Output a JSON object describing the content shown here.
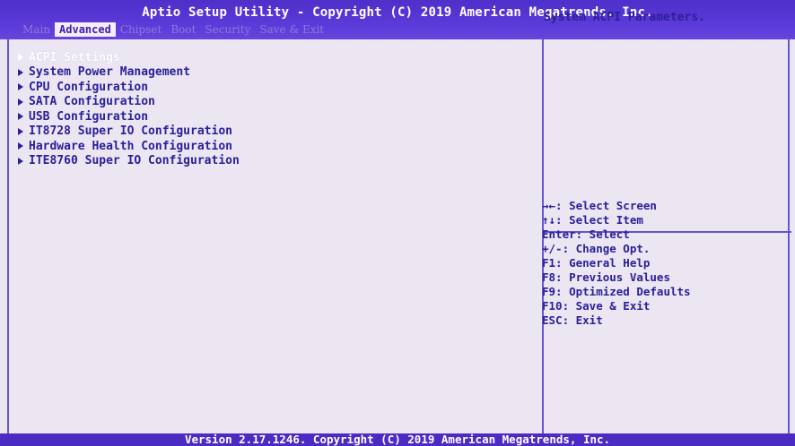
{
  "header": {
    "title": "Aptio Setup Utility - Copyright (C) 2019 American Megatrends, Inc.",
    "tabs": [
      {
        "label": "Main",
        "active": false
      },
      {
        "label": "Advanced",
        "active": true
      },
      {
        "label": "Chipset",
        "active": false
      },
      {
        "label": "Boot",
        "active": false
      },
      {
        "label": "Security",
        "active": false
      },
      {
        "label": "Save & Exit",
        "active": false
      }
    ]
  },
  "menu": {
    "items": [
      {
        "label": "ACPI Settings",
        "selected": true
      },
      {
        "label": "System Power Management",
        "selected": false
      },
      {
        "label": "CPU Configuration",
        "selected": false
      },
      {
        "label": "SATA Configuration",
        "selected": false
      },
      {
        "label": "USB Configuration",
        "selected": false
      },
      {
        "label": "IT8728 Super IO Configuration",
        "selected": false
      },
      {
        "label": "Hardware Health Configuration",
        "selected": false
      },
      {
        "label": "ITE8760 Super IO Configuration",
        "selected": false
      }
    ]
  },
  "help": {
    "description": "System ACPI Parameters.",
    "keys": [
      "→←: Select Screen",
      "↑↓: Select Item",
      "Enter: Select",
      "+/-: Change Opt.",
      "F1: General Help",
      "F8: Previous Values",
      "F9: Optimized Defaults",
      "F10: Save & Exit",
      "ESC: Exit"
    ]
  },
  "footer": {
    "text": "Version 2.17.1246. Copyright (C) 2019 American Megatrends, Inc."
  },
  "colors": {
    "header_bg": "#5a3ad8",
    "panel_bg": "#ece6f3",
    "text": "#2a2099",
    "selected_text": "#ffffff",
    "border": "#6a55d0"
  }
}
